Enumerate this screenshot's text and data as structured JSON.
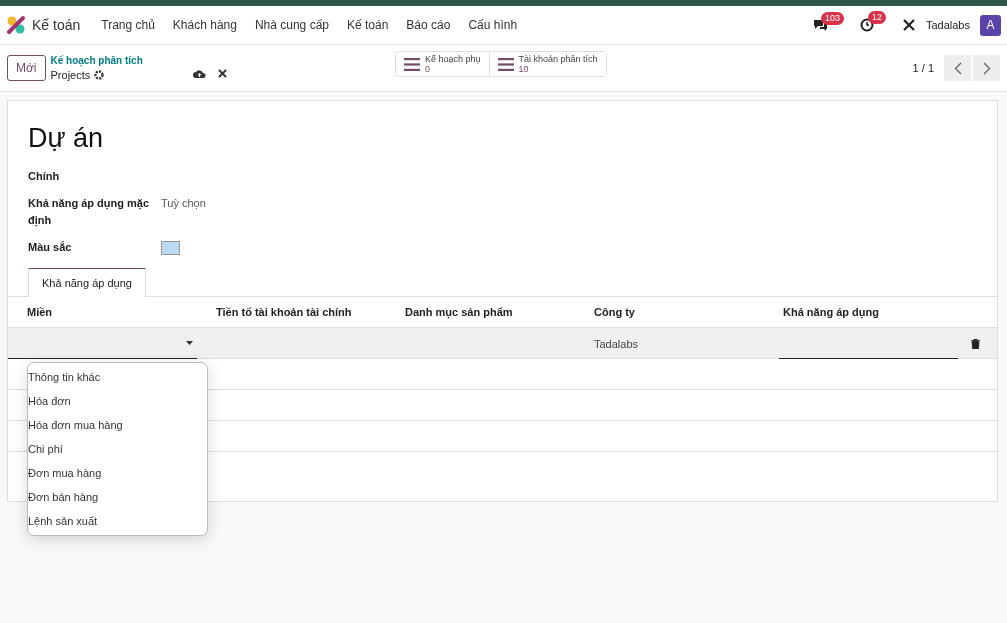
{
  "app": {
    "name": "Kế toán"
  },
  "menu": [
    "Trang chủ",
    "Khách hàng",
    "Nhà cung cấp",
    "Kế toán",
    "Báo cáo",
    "Cấu hình"
  ],
  "systray": {
    "messages_count": "103",
    "activities_count": "12",
    "company": "Tadalabs",
    "avatar": "A"
  },
  "control_panel": {
    "new_button": "Mới",
    "breadcrumb": "Kế hoạch phân tích",
    "record": "Projects",
    "smart_buttons": [
      {
        "label": "Kế hoạch phụ",
        "value": "0"
      },
      {
        "label": "Tài khoản phân tích",
        "value": "10"
      }
    ],
    "pager": "1 / 1"
  },
  "form": {
    "title": "Dự án",
    "fields": [
      {
        "label": "Chính"
      },
      {
        "label": "Khả năng áp dụng mặc định",
        "value": "Tuỳ chọn"
      }
    ],
    "color_label": "Màu sắc",
    "color": "#bcd8f5",
    "tabs": [
      {
        "label": "Khả năng áp dụng",
        "selected": true
      }
    ],
    "table": {
      "columns": [
        "Miền",
        "Tiền tố tài khoản tài chính",
        "Danh mục sản phẩm",
        "Công ty",
        "Khả năng áp dụng"
      ],
      "rows": [
        {
          "company": "Tadalabs",
          "editing": true
        },
        {
          "editing": false
        },
        {
          "editing": false
        },
        {
          "editing": false
        }
      ]
    },
    "dropdown": [
      "Thông tin khác",
      "Hóa đơn",
      "Hóa đơn mua hàng",
      "Chi phí",
      "Đơn mua hàng",
      "Đơn bán hàng",
      "Lệnh sản xuất"
    ]
  }
}
